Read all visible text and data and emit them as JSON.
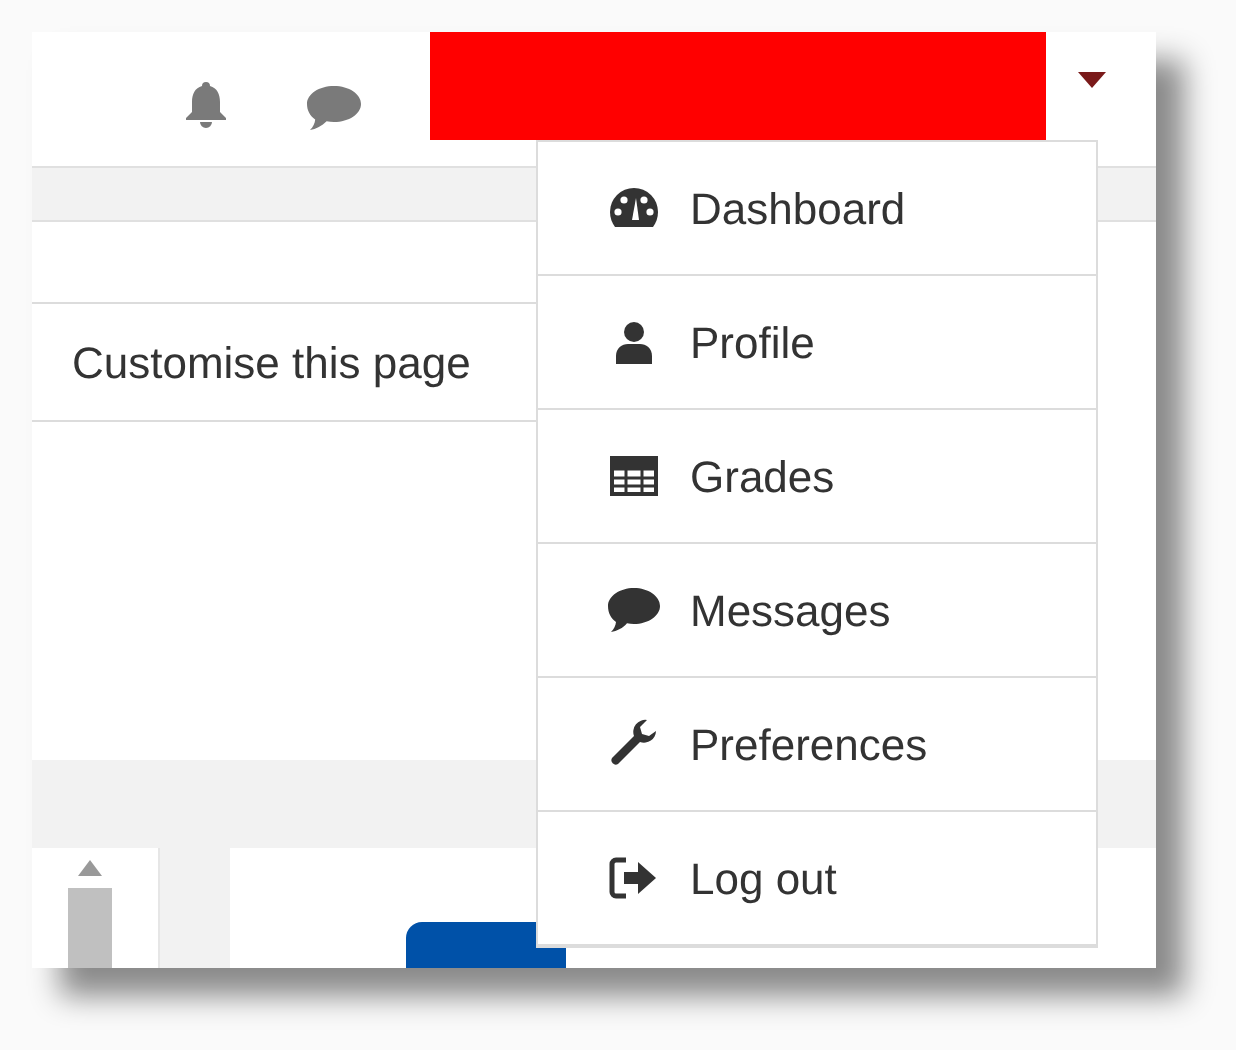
{
  "page": {
    "customise_button": "Customise this page"
  },
  "user_menu": {
    "expanded": true,
    "items": [
      {
        "label": "Dashboard"
      },
      {
        "label": "Profile"
      },
      {
        "label": "Grades"
      },
      {
        "label": "Messages"
      },
      {
        "label": "Preferences"
      },
      {
        "label": "Log out"
      }
    ]
  }
}
